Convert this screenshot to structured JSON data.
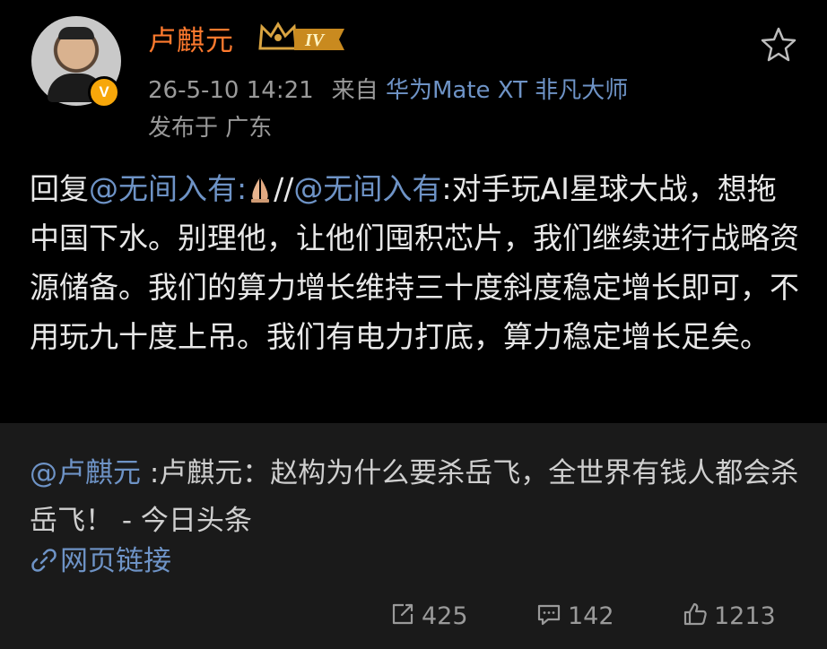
{
  "post": {
    "username": "卢麒元",
    "level": "IV",
    "verified_mark": "V",
    "timestamp": "26-5-10 14:21",
    "source_prefix": "来自",
    "device": "华为Mate XT 非凡大师",
    "location": "发布于 广东",
    "body": {
      "reply_prefix": "回复",
      "mention_1": "@无间入有:",
      "separator": "//",
      "mention_2": "@无间入有",
      "text": ":对手玩AI星球大战，想拖中国下水。别理他，让他们囤积芯片，我们继续进行战略资源储备。我们的算力增长维持三十度斜度稳定增长即可，不用玩九十度上吊。我们有电力打底，算力稳定增长足矣。"
    },
    "icons": {
      "favorite": "star-icon",
      "emoji": "folded-hands-emoji"
    }
  },
  "retweet": {
    "mention": "@卢麒元",
    "text": " :卢麒元：赵构为什么要杀岳飞，全世界有钱人都会杀岳飞！  - 今日头条",
    "link_label": "网页链接",
    "actions": {
      "repost_count": "425",
      "comment_count": "142",
      "like_count": "1213"
    }
  },
  "colors": {
    "background": "#000000",
    "retweet_background": "#1a1a1a",
    "username": "#ff7a2e",
    "link": "#6e93c6",
    "muted": "#9a9a9a",
    "badge": "#f7a70a"
  }
}
